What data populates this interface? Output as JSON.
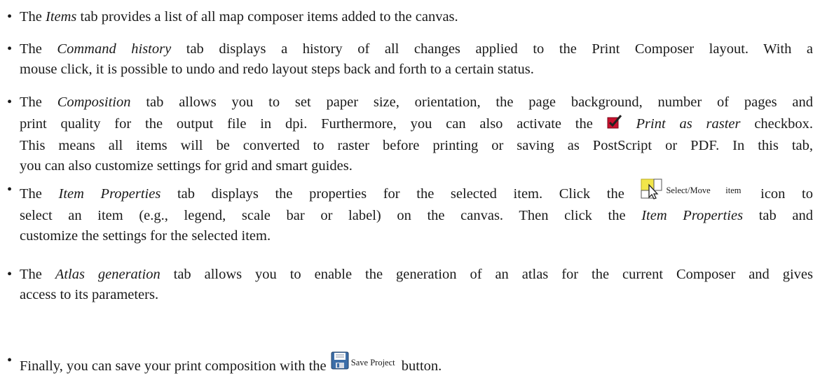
{
  "bullet_char": "•",
  "items_tab": {
    "t1": "The ",
    "em": "Items",
    "t2": " tab provides a list of all map composer items added to the canvas."
  },
  "command_history": {
    "t1": "The ",
    "em": "Command history",
    "t2": " tab displays a history of all changes applied to the Print Composer layout. With a",
    "line2": "mouse click, it is possible to undo and redo layout steps back and forth to a certain status."
  },
  "composition": {
    "t1": "The ",
    "em": "Composition",
    "t2": " tab allows you to set paper size, orientation, the page background, number of pages and",
    "line2a": "print quality for the output file in dpi. Furthermore, you can also activate the ",
    "em2": "Print as raster",
    "line2b": " checkbox.",
    "line3": "This means all items will be converted to raster before printing or saving as PostScript or PDF. In this tab,",
    "line4": "you can also customize settings for grid and smart guides."
  },
  "item_properties": {
    "t1": "The ",
    "em": "Item Properties",
    "t2": " tab displays the properties for the selected item.  Click the ",
    "icon_label": "Select/Move item",
    "t3": " icon to",
    "line2a": "select an item (e.g., legend, scale bar or label) on the canvas.  Then click the ",
    "em2": "Item Properties",
    "line2b": " tab and",
    "line3": "customize the settings for the selected item."
  },
  "atlas": {
    "t1": "The ",
    "em": "Atlas generation",
    "t2": " tab allows you to enable the generation of an atlas for the current Composer and gives",
    "line2": "access to its parameters."
  },
  "finally": {
    "t1": "Finally, you can save your print composition with the ",
    "icon_label": "Save Project",
    "t2": " button."
  },
  "icons": {
    "checkbox": "checkbox-checked-icon",
    "select_move": "select-move-item-icon",
    "save": "save-project-icon"
  },
  "colors": {
    "checkbox_red": "#c8102e",
    "select_yellow": "#f2e64a",
    "save_blue": "#3c6ea8"
  }
}
